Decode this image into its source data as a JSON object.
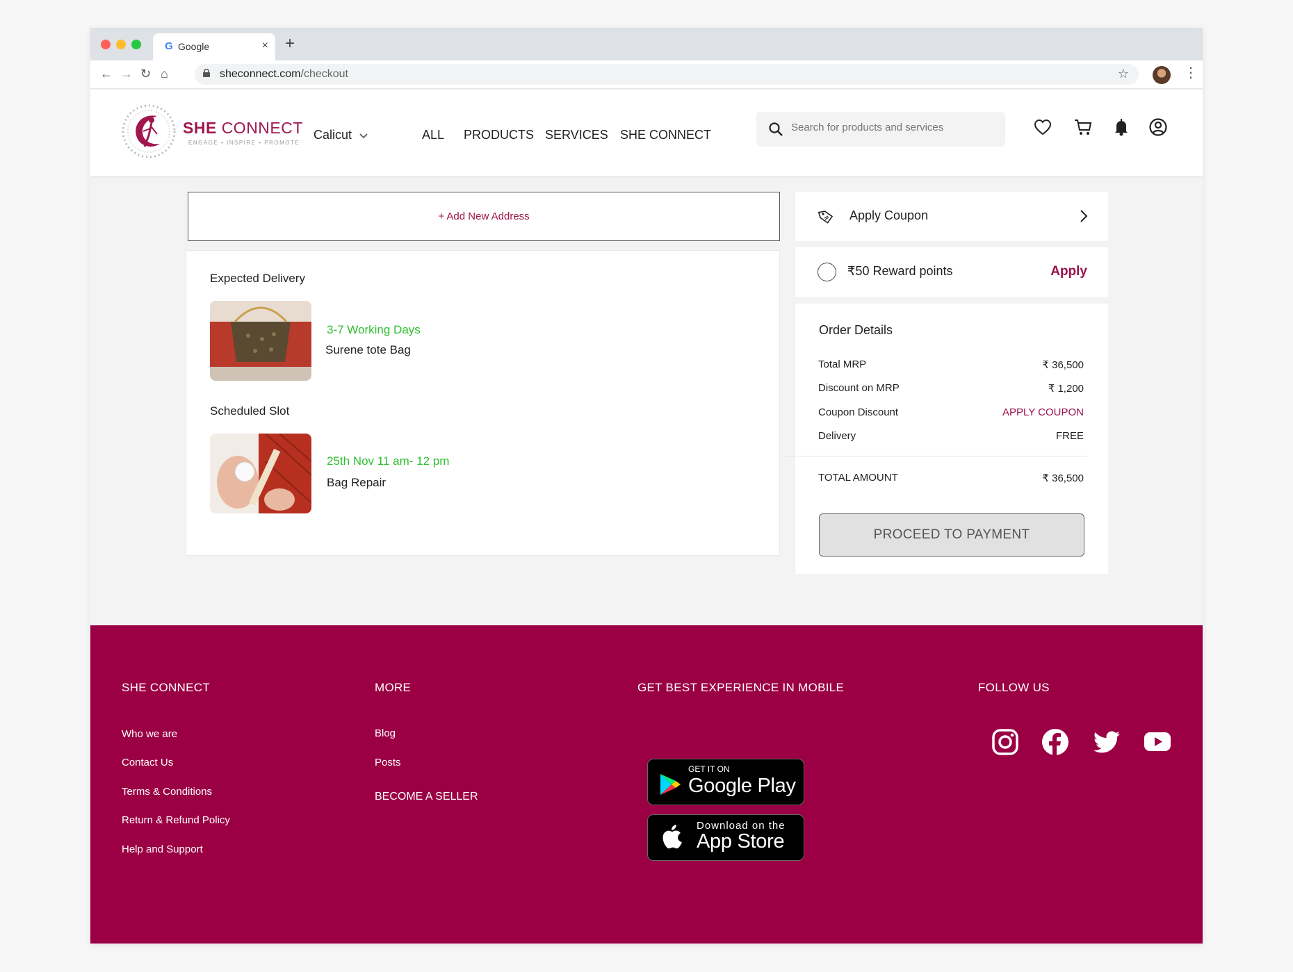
{
  "browser": {
    "tab_title": "Google",
    "tab_close": "×",
    "new_tab": "+",
    "url_domain": "sheconnect.com",
    "url_path": "/checkout",
    "back": "←",
    "forward": "→",
    "reload": "↻",
    "home": "⌂",
    "star": "☆",
    "menu": "⋮"
  },
  "header": {
    "brand_bold": "SHE",
    "brand_light": "CONNECT",
    "tagline": "ENGAGE • INSPIRE • PROMOTE",
    "city": "Calicut",
    "nav": [
      "ALL",
      "PRODUCTS",
      "SERVICES",
      "SHE CONNECT"
    ],
    "search_placeholder": "Search for products and services",
    "icons": [
      "heart-icon",
      "cart-icon",
      "bell-icon",
      "account-icon"
    ]
  },
  "checkout": {
    "add_address": "+ Add New Address",
    "expected_delivery_title": "Expected Delivery",
    "delivery_time": "3-7 Working Days",
    "product_name": "Surene tote Bag",
    "scheduled_slot_title": "Scheduled Slot",
    "slot_date": "25th Nov  11 am- 12 pm",
    "service_name": "Bag Repair"
  },
  "sidebar": {
    "apply_coupon": "Apply Coupon",
    "reward_points": "₹50 Reward points",
    "reward_apply": "Apply",
    "order_details_title": "Order Details",
    "rows": [
      {
        "label": "Total MRP",
        "value": "₹  36,500"
      },
      {
        "label": "Discount on MRP",
        "value": "₹ 1,200"
      },
      {
        "label": "Coupon Discount",
        "value": "APPLY COUPON"
      },
      {
        "label": "Delivery",
        "value": "FREE"
      }
    ],
    "total_label": "TOTAL AMOUNT",
    "total_value": "₹ 36,500",
    "proceed": "PROCEED TO PAYMENT"
  },
  "footer": {
    "col1_title": "SHE CONNECT",
    "col1_links": [
      "Who we are",
      "Contact Us",
      "Terms & Conditions",
      "Return & Refund Policy",
      "Help and Support"
    ],
    "col2_title": "MORE",
    "col2_links": [
      "Blog",
      "Posts"
    ],
    "become_seller": "BECOME A SELLER",
    "col3_title": "GET BEST EXPERIENCE IN MOBILE",
    "google_play_small": "GET IT ON",
    "google_play_big": "Google Play",
    "app_store_small": "Download on the",
    "app_store_big": "App Store",
    "col4_title": "FOLLOW US",
    "social": [
      "instagram-icon",
      "facebook-icon",
      "twitter-icon",
      "youtube-icon"
    ]
  },
  "colors": {
    "brand": "#9b0044",
    "accent_green": "#2fbf2f",
    "link": "#9b1249"
  }
}
